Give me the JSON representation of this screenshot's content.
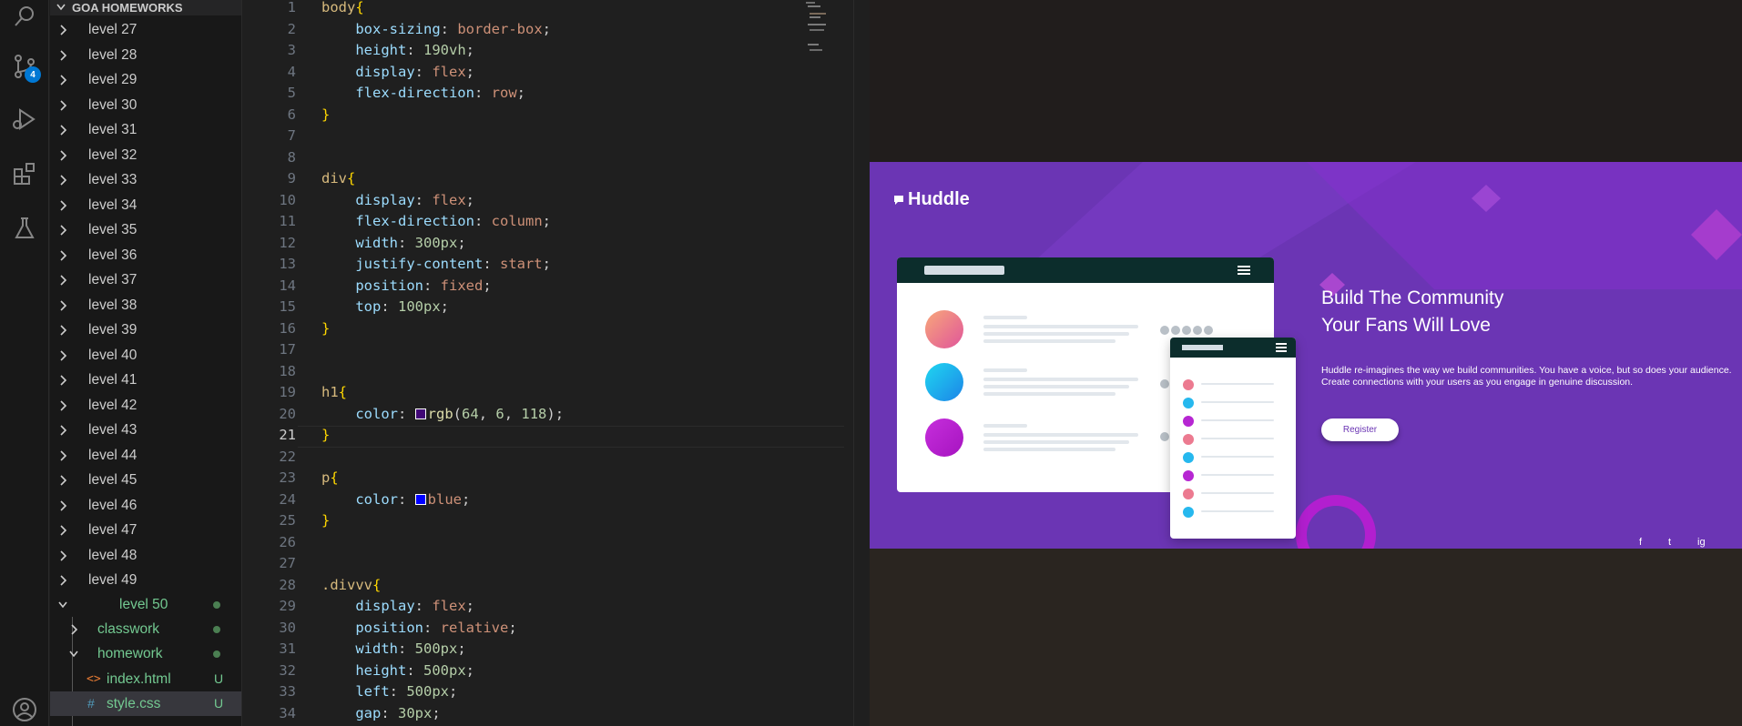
{
  "explorer": {
    "folder": "GOA HOMEWORKS",
    "levels": [
      "level 27",
      "level 28",
      "level 29",
      "level 30",
      "level 31",
      "level 32",
      "level 33",
      "level 34",
      "level 35",
      "level 36",
      "level 37",
      "level 38",
      "level 39",
      "level 40",
      "level 41",
      "level 42",
      "level 43",
      "level 44",
      "level 45",
      "level 46",
      "level 47",
      "level 48",
      "level 49"
    ],
    "open_level": "level 50",
    "classwork": "classwork",
    "homework": "homework",
    "files": [
      {
        "name": "index.html",
        "status": "U"
      },
      {
        "name": "style.css",
        "status": "U"
      }
    ]
  },
  "scm_badge": "4",
  "editor": {
    "current_line": "21",
    "lines": [
      {
        "n": "1",
        "t": "body{"
      },
      {
        "n": "2",
        "t": "    box-sizing: border-box;"
      },
      {
        "n": "3",
        "t": "    height: 190vh;"
      },
      {
        "n": "4",
        "t": "    display: flex;"
      },
      {
        "n": "5",
        "t": "    flex-direction: row;"
      },
      {
        "n": "6",
        "t": "}"
      },
      {
        "n": "7",
        "t": ""
      },
      {
        "n": "8",
        "t": ""
      },
      {
        "n": "9",
        "t": "div{"
      },
      {
        "n": "10",
        "t": "    display: flex;"
      },
      {
        "n": "11",
        "t": "    flex-direction: column;"
      },
      {
        "n": "12",
        "t": "    width: 300px;"
      },
      {
        "n": "13",
        "t": "    justify-content: start;"
      },
      {
        "n": "14",
        "t": "    position: fixed;"
      },
      {
        "n": "15",
        "t": "    top: 100px;"
      },
      {
        "n": "16",
        "t": "}"
      },
      {
        "n": "17",
        "t": ""
      },
      {
        "n": "18",
        "t": ""
      },
      {
        "n": "19",
        "t": "h1{"
      },
      {
        "n": "20",
        "t": "    color: rgb(64, 6, 118);"
      },
      {
        "n": "21",
        "t": "}"
      },
      {
        "n": "22",
        "t": ""
      },
      {
        "n": "23",
        "t": "p{"
      },
      {
        "n": "24",
        "t": "    color: blue;"
      },
      {
        "n": "25",
        "t": "}"
      },
      {
        "n": "26",
        "t": ""
      },
      {
        "n": "27",
        "t": ""
      },
      {
        "n": "28",
        "t": ".divvv{"
      },
      {
        "n": "29",
        "t": "    display: flex;"
      },
      {
        "n": "30",
        "t": "    position: relative;"
      },
      {
        "n": "31",
        "t": "    width: 500px;"
      },
      {
        "n": "32",
        "t": "    height: 500px;"
      },
      {
        "n": "33",
        "t": "    left: 500px;"
      },
      {
        "n": "34",
        "t": "    gap: 30px;"
      }
    ]
  },
  "preview": {
    "logo": "Huddle",
    "headline_1": "Build The Community",
    "headline_2": "Your Fans Will Love",
    "description": "Huddle re-imagines the way we build communities. You have a voice, but so does your audience. Create connections with your users as you engage in genuine discussion.",
    "register": "Register",
    "social": [
      "f",
      "t",
      "ig"
    ]
  },
  "colors": {
    "hero": "#6b35b4",
    "h1_swatch": "#400676",
    "p_swatch": "#0000ff"
  }
}
